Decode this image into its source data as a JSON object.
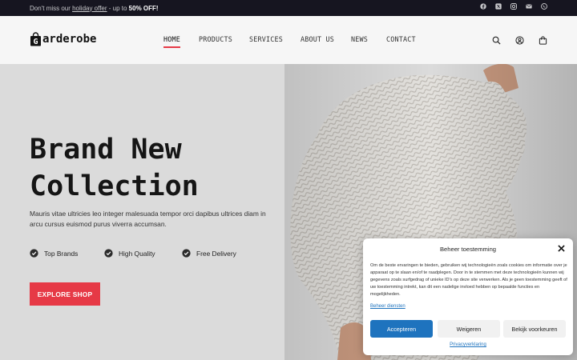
{
  "topbar": {
    "promo_prefix": "Don't miss our ",
    "promo_link": "holiday offer",
    "promo_mid": " - up to ",
    "promo_bold": "50% OFF!",
    "social": [
      "facebook-icon",
      "x-twitter-icon",
      "instagram-icon",
      "email-icon",
      "whatsapp-icon"
    ]
  },
  "header": {
    "logo_text": "arderobe",
    "logo_letter": "G",
    "nav": [
      "HOME",
      "PRODUCTS",
      "SERVICES",
      "ABOUT US",
      "NEWS",
      "CONTACT"
    ],
    "active_nav": "HOME",
    "icons": [
      "search-icon",
      "account-icon",
      "cart-icon"
    ]
  },
  "hero": {
    "title_line1": "Brand New",
    "title_line2": "Collection",
    "subtitle": "Mauris vitae ultricies leo integer malesuada tempor orci dapibus ultrices diam in arcu cursus euismod purus viverra accumsan.",
    "features": [
      "Top Brands",
      "High Quality",
      "Free Delivery"
    ],
    "cta": "EXPLORE SHOP"
  },
  "consent": {
    "title": "Beheer toestemming",
    "body": "Om de beste ervaringen te bieden, gebruiken wij technologieën zoals cookies om informatie over je apparaat op te slaan en/of te raadplegen. Door in te stemmen met deze technologieën kunnen wij gegevens zoals surfgedrag of unieke ID's op deze site verwerken. Als je geen toestemming geeft of uw toestemming intrekt, kan dit een nadelige invloed hebben op bepaalde functies en mogelijkheden.",
    "manage_link": "Beheer diensten",
    "accept": "Accepteren",
    "deny": "Weigeren",
    "preferences": "Bekijk voorkeuren",
    "privacy": "Privacyverklaring"
  },
  "colors": {
    "accent": "#e63946",
    "topbar_bg": "#161520",
    "consent_primary": "#1e73be"
  }
}
